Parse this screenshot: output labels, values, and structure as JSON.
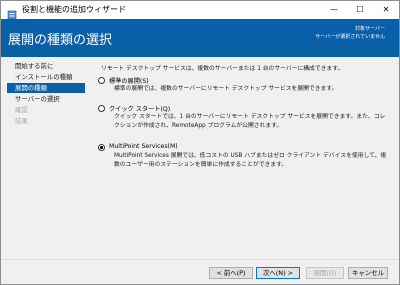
{
  "window": {
    "title": "役割と機能の追加ウィザード",
    "controls": {
      "minimize": "—",
      "maximize": "☐",
      "close": "✕"
    }
  },
  "header": {
    "title": "展開の種類の選択",
    "destination_label": "対象サーバー",
    "destination_value": "サーバーが選択されていません"
  },
  "sidebar": {
    "items": [
      {
        "label": "開始する前に",
        "state": "normal"
      },
      {
        "label": "インストールの種類",
        "state": "normal"
      },
      {
        "label": "展開の種類",
        "state": "active"
      },
      {
        "label": "サーバーの選択",
        "state": "normal"
      },
      {
        "label": "確認",
        "state": "disabled"
      },
      {
        "label": "結果",
        "state": "disabled"
      }
    ]
  },
  "main": {
    "intro": "リモート デスクトップ サービスは、複数のサーバーまたは 1 台のサーバーに構成できます。",
    "options": [
      {
        "label": "標準の展開(S)",
        "description": "標準の展開では、複数のサーバーにリモート デスクトップ サービスを展開できます。",
        "selected": false
      },
      {
        "label": "クイック スタート(Q)",
        "description": "クイック スタートでは、1 台のサーバーにリモート デスクトップ サービスを展開できます。また、コレクションが作成され、RemoteApp プログラムが公開されます。",
        "selected": false
      },
      {
        "label": "MultiPoint Services(M)",
        "description": "MultiPoint Services 展開では、低コストの USB ハブまたはゼロ クライアント デバイスを使用して、複数のユーザー用のステーションを簡単に作成することができます。",
        "selected": true
      }
    ]
  },
  "footer": {
    "previous": "< 前へ(P)",
    "next": "次へ(N) >",
    "deploy": "展開(D)",
    "cancel": "キャンセル"
  },
  "colors": {
    "accent": "#0a5fa9",
    "background": "#f0f0f0"
  }
}
